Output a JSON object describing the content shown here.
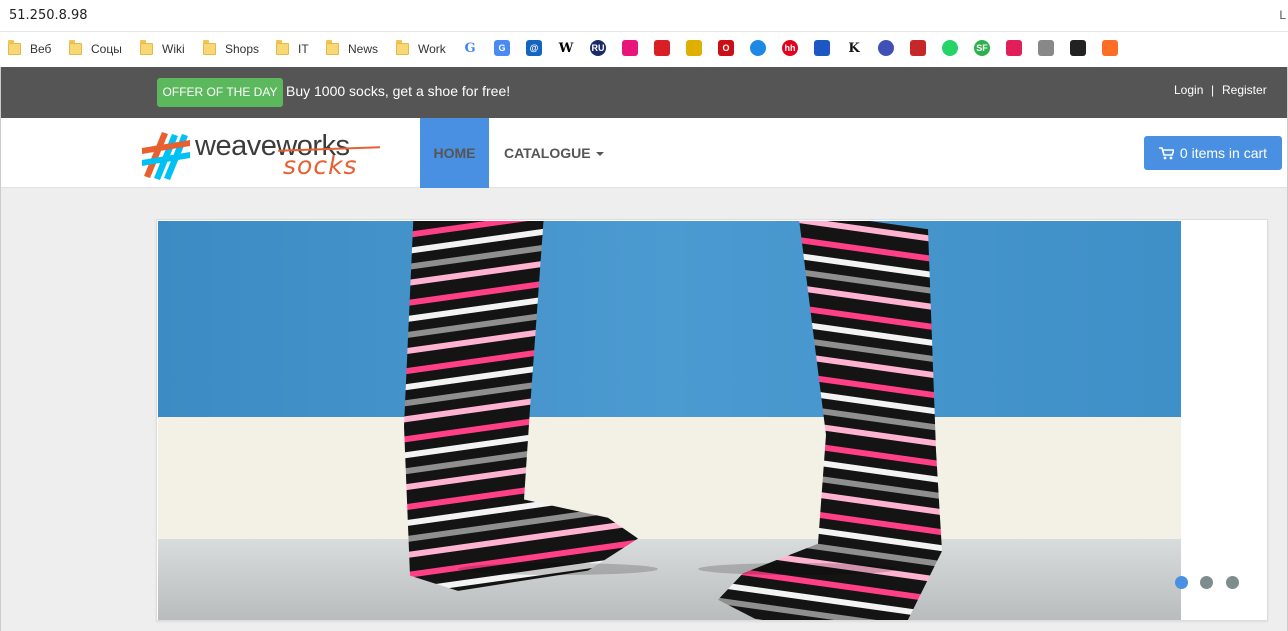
{
  "browser": {
    "url": "51.250.8.98",
    "right_glyph": "L"
  },
  "bookmarks": {
    "folders": [
      "Веб",
      "Соцы",
      "Wiki",
      "Shops",
      "IT",
      "News",
      "Work"
    ],
    "icons": [
      {
        "name": "google-icon",
        "glyph": "G",
        "color": "#4285f4"
      },
      {
        "name": "google-translate-icon",
        "glyph": "G",
        "color": "#4a8af4"
      },
      {
        "name": "mail-at-icon",
        "glyph": "@",
        "color": "#1565c0"
      },
      {
        "name": "wikipedia-icon",
        "glyph": "W",
        "color": "#000000"
      },
      {
        "name": "ru-icon",
        "glyph": "RU",
        "color": "#1b2a6b"
      },
      {
        "name": "pink-square-icon",
        "glyph": "",
        "color": "#e8157a"
      },
      {
        "name": "red-figure-icon",
        "glyph": "",
        "color": "#d81f26"
      },
      {
        "name": "badge-icon",
        "glyph": "",
        "color": "#e0b000"
      },
      {
        "name": "opera-icon",
        "glyph": "O",
        "color": "#cc0f16"
      },
      {
        "name": "drop-icon",
        "glyph": "",
        "color": "#1e88e5"
      },
      {
        "name": "hh-icon",
        "glyph": "hh",
        "color": "#e4001b"
      },
      {
        "name": "flag-ru-icon",
        "glyph": "",
        "color": "#1c57c4"
      },
      {
        "name": "k-icon",
        "glyph": "K",
        "color": "#111111"
      },
      {
        "name": "planet-icon",
        "glyph": "",
        "color": "#3f51b5"
      },
      {
        "name": "emblem-icon",
        "glyph": "",
        "color": "#c62828"
      },
      {
        "name": "whatsapp-icon",
        "glyph": "",
        "color": "#25d366"
      },
      {
        "name": "sf-icon",
        "glyph": "SF",
        "color": "#2bb24c"
      },
      {
        "name": "slack-icon",
        "glyph": "",
        "color": "#e01e5a"
      },
      {
        "name": "book-icon",
        "glyph": "",
        "color": "#888888"
      },
      {
        "name": "github-icon",
        "glyph": "",
        "color": "#222222"
      },
      {
        "name": "gitlab-icon",
        "glyph": "",
        "color": "#fc6d26"
      }
    ]
  },
  "offer": {
    "badge": "OFFER OF THE DAY",
    "text": "Buy 1000 socks, get a shoe for free!",
    "login": "Login",
    "separator": "|",
    "register": "Register"
  },
  "nav": {
    "logo_word1": "weaveworks",
    "logo_word2": "socks",
    "home": "HOME",
    "catalogue": "CATALOGUE",
    "cart": "0 items in cart"
  },
  "carousel": {
    "dots": 3,
    "active_index": 0
  },
  "colors": {
    "accent": "#4a90e2",
    "offer_green": "#5cb85c",
    "topbar": "#555555",
    "logo_orange": "#e8602f"
  }
}
